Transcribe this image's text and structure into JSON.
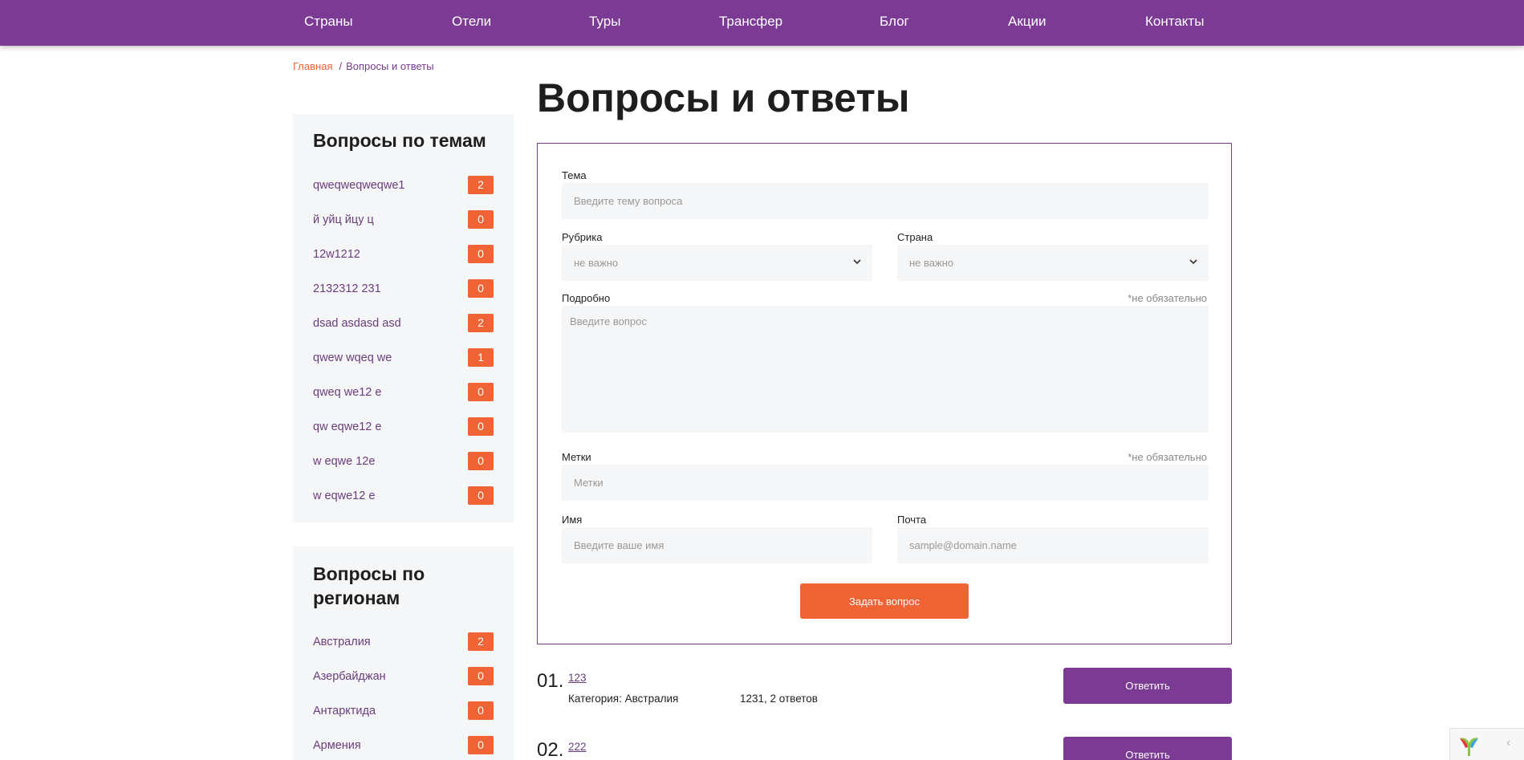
{
  "nav": {
    "items": [
      "Страны",
      "Отели",
      "Туры",
      "Трансфер",
      "Блог",
      "Акции",
      "Контакты"
    ]
  },
  "breadcrumb": {
    "home": "Главная",
    "separator": "/",
    "current": "Вопросы и ответы"
  },
  "page_title": "Вопросы и ответы",
  "sidebar": {
    "topics": {
      "title": "Вопросы по темам",
      "items": [
        {
          "label": "qweqweqweqwe1",
          "count": "2"
        },
        {
          "label": "й уйц йцу ц",
          "count": "0"
        },
        {
          "label": "12w1212",
          "count": "0"
        },
        {
          "label": "2132312 231",
          "count": "0"
        },
        {
          "label": "dsad asdasd asd",
          "count": "2"
        },
        {
          "label": "qwew wqeq we",
          "count": "1"
        },
        {
          "label": "qweq we12 e",
          "count": "0"
        },
        {
          "label": "qw eqwe12 e",
          "count": "0"
        },
        {
          "label": "w eqwe 12e",
          "count": "0"
        },
        {
          "label": "w eqwe12 e",
          "count": "0"
        }
      ]
    },
    "regions": {
      "title_line1": "Вопросы по",
      "title_line2": "регионам",
      "items": [
        {
          "label": "Австралия",
          "count": "2"
        },
        {
          "label": "Азербайджан",
          "count": "0"
        },
        {
          "label": "Антарктида",
          "count": "0"
        },
        {
          "label": "Армения",
          "count": "0"
        }
      ]
    }
  },
  "form": {
    "topic_label": "Тема",
    "topic_placeholder": "Введите тему вопроса",
    "rubric_label": "Рубрика",
    "rubric_value": "не важно",
    "country_label": "Страна",
    "country_value": "не важно",
    "details_label": "Подробно",
    "optional_note": "*не обязательно",
    "details_placeholder": "Введите вопрос",
    "tags_label": "Метки",
    "tags_placeholder": "Метки",
    "name_label": "Имя",
    "name_placeholder": "Введите ваше имя",
    "email_label": "Почта",
    "email_placeholder": "sample@domain.name",
    "submit_label": "Задать вопрос"
  },
  "questions": [
    {
      "num": "01.",
      "title": "123",
      "category": "Категория: Австралия",
      "answers": "1231, 2 ответов",
      "reply_label": "Ответить"
    },
    {
      "num": "02.",
      "title": "222",
      "reply_label": "Ответить"
    }
  ],
  "colors": {
    "brand_purple": "#7b3a93",
    "accent_orange": "#ef6334",
    "panel_bg": "#f4f6f7"
  },
  "icons": [
    "chevron-down-icon",
    "yii-logo-icon",
    "chevron-left-icon"
  ]
}
